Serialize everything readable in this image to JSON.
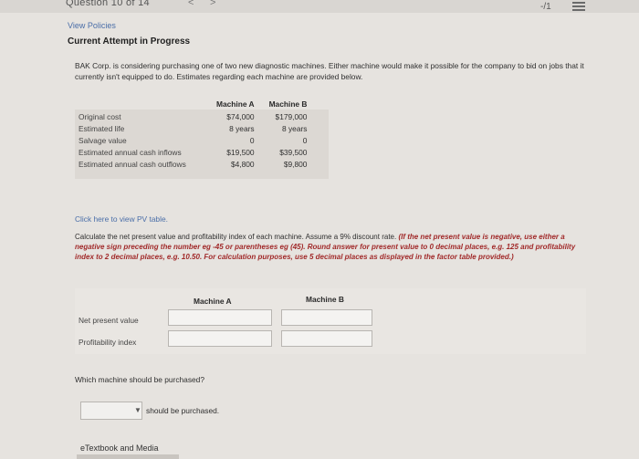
{
  "header": {
    "question_counter": "Question 10 of 14",
    "prev_symbol": "<",
    "next_symbol": ">",
    "score": "-/1"
  },
  "links": {
    "view_policies": "View Policies",
    "pv_table": "Click here to view PV table."
  },
  "attempt_status": "Current Attempt in Progress",
  "intro_text": "BAK Corp. is considering purchasing one of two new diagnostic machines. Either machine would make it possible for the company to bid on jobs that it currently isn't equipped to do. Estimates regarding each machine are provided below.",
  "table": {
    "headers": [
      "Machine A",
      "Machine B"
    ],
    "rows": [
      {
        "label": "Original cost",
        "a": "$74,000",
        "b": "$179,000"
      },
      {
        "label": "Estimated life",
        "a": "8 years",
        "b": "8 years"
      },
      {
        "label": "Salvage value",
        "a": "0",
        "b": "0"
      },
      {
        "label": "Estimated annual cash inflows",
        "a": "$19,500",
        "b": "$39,500"
      },
      {
        "label": "Estimated annual cash outflows",
        "a": "$4,800",
        "b": "$9,800"
      }
    ]
  },
  "instructions": {
    "plain": "Calculate the net present value and profitability index of each machine. Assume a 9% discount rate. ",
    "emphasis": "(If the net present value is negative, use either a negative sign preceding the number eg -45 or parentheses eg (45). Round answer for present value to 0 decimal places, e.g. 125 and profitability index to 2 decimal places, e.g. 10.50. For calculation purposes, use 5 decimal places as displayed in the factor table provided.)"
  },
  "answer": {
    "col_a": "Machine A",
    "col_b": "Machine B",
    "npv_label": "Net present value",
    "pi_label": "Profitability index",
    "npv_a": "",
    "npv_b": "",
    "pi_a": "",
    "pi_b": ""
  },
  "purchase": {
    "question": "Which machine should be purchased?",
    "selected": "",
    "suffix": "should be purchased."
  },
  "footer": {
    "etextbook": "eTextbook and Media"
  }
}
